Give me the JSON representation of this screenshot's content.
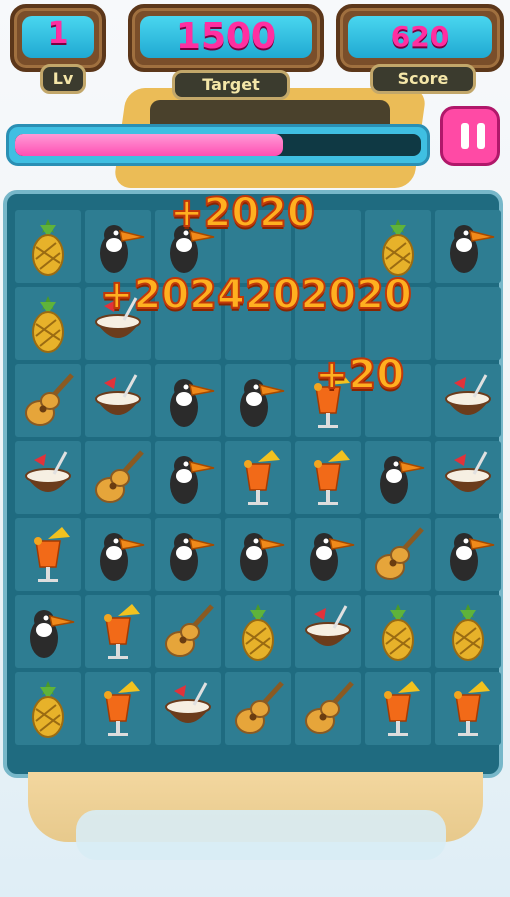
{
  "hud": {
    "level_value": "1",
    "level_label": "Lv",
    "target_value": "1500",
    "target_label": "Target",
    "score_value": "620",
    "score_label": "Score"
  },
  "progress": 0.66,
  "board": [
    [
      "pineapple",
      "toucan",
      "toucan",
      "empty",
      "empty",
      "pineapple",
      "toucan"
    ],
    [
      "pineapple",
      "coconut",
      "empty",
      "empty",
      "empty",
      "empty",
      "empty"
    ],
    [
      "guitar",
      "coconut",
      "toucan",
      "toucan",
      "cocktail",
      "empty",
      "coconut"
    ],
    [
      "coconut",
      "guitar",
      "toucan",
      "cocktail",
      "cocktail",
      "toucan",
      "coconut"
    ],
    [
      "cocktail",
      "toucan",
      "toucan",
      "toucan",
      "toucan",
      "guitar",
      "toucan"
    ],
    [
      "toucan",
      "cocktail",
      "guitar",
      "pineapple",
      "coconut",
      "pineapple",
      "pineapple"
    ],
    [
      "pineapple",
      "cocktail",
      "coconut",
      "guitar",
      "guitar",
      "cocktail",
      "cocktail"
    ]
  ],
  "floating_scores": [
    "+2020",
    "+2024202020",
    "+20"
  ]
}
